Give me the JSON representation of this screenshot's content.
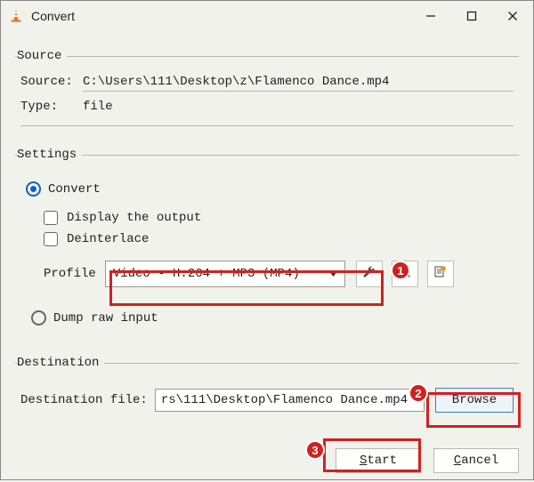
{
  "window": {
    "title": "Convert"
  },
  "source": {
    "legend": "Source",
    "source_label": "Source:",
    "source_value": "C:\\Users\\111\\Desktop\\z\\Flamenco Dance.mp4",
    "type_label": "Type:",
    "type_value": "file"
  },
  "settings": {
    "legend": "Settings",
    "convert_label": "Convert",
    "display_output_label": "Display the output",
    "deinterlace_label": "Deinterlace",
    "profile_label": "Profile",
    "profile_value": "Video - H.264 + MP3 (MP4)",
    "dump_label": "Dump raw input"
  },
  "destination": {
    "legend": "Destination",
    "dest_label": "Destination file:",
    "dest_value": "rs\\111\\Desktop\\Flamenco Dance.mp4",
    "browse_label": "Browse"
  },
  "buttons": {
    "start": "Start",
    "cancel": "Cancel"
  },
  "annotations": {
    "b1": "1",
    "b2": "2",
    "b3": "3"
  }
}
